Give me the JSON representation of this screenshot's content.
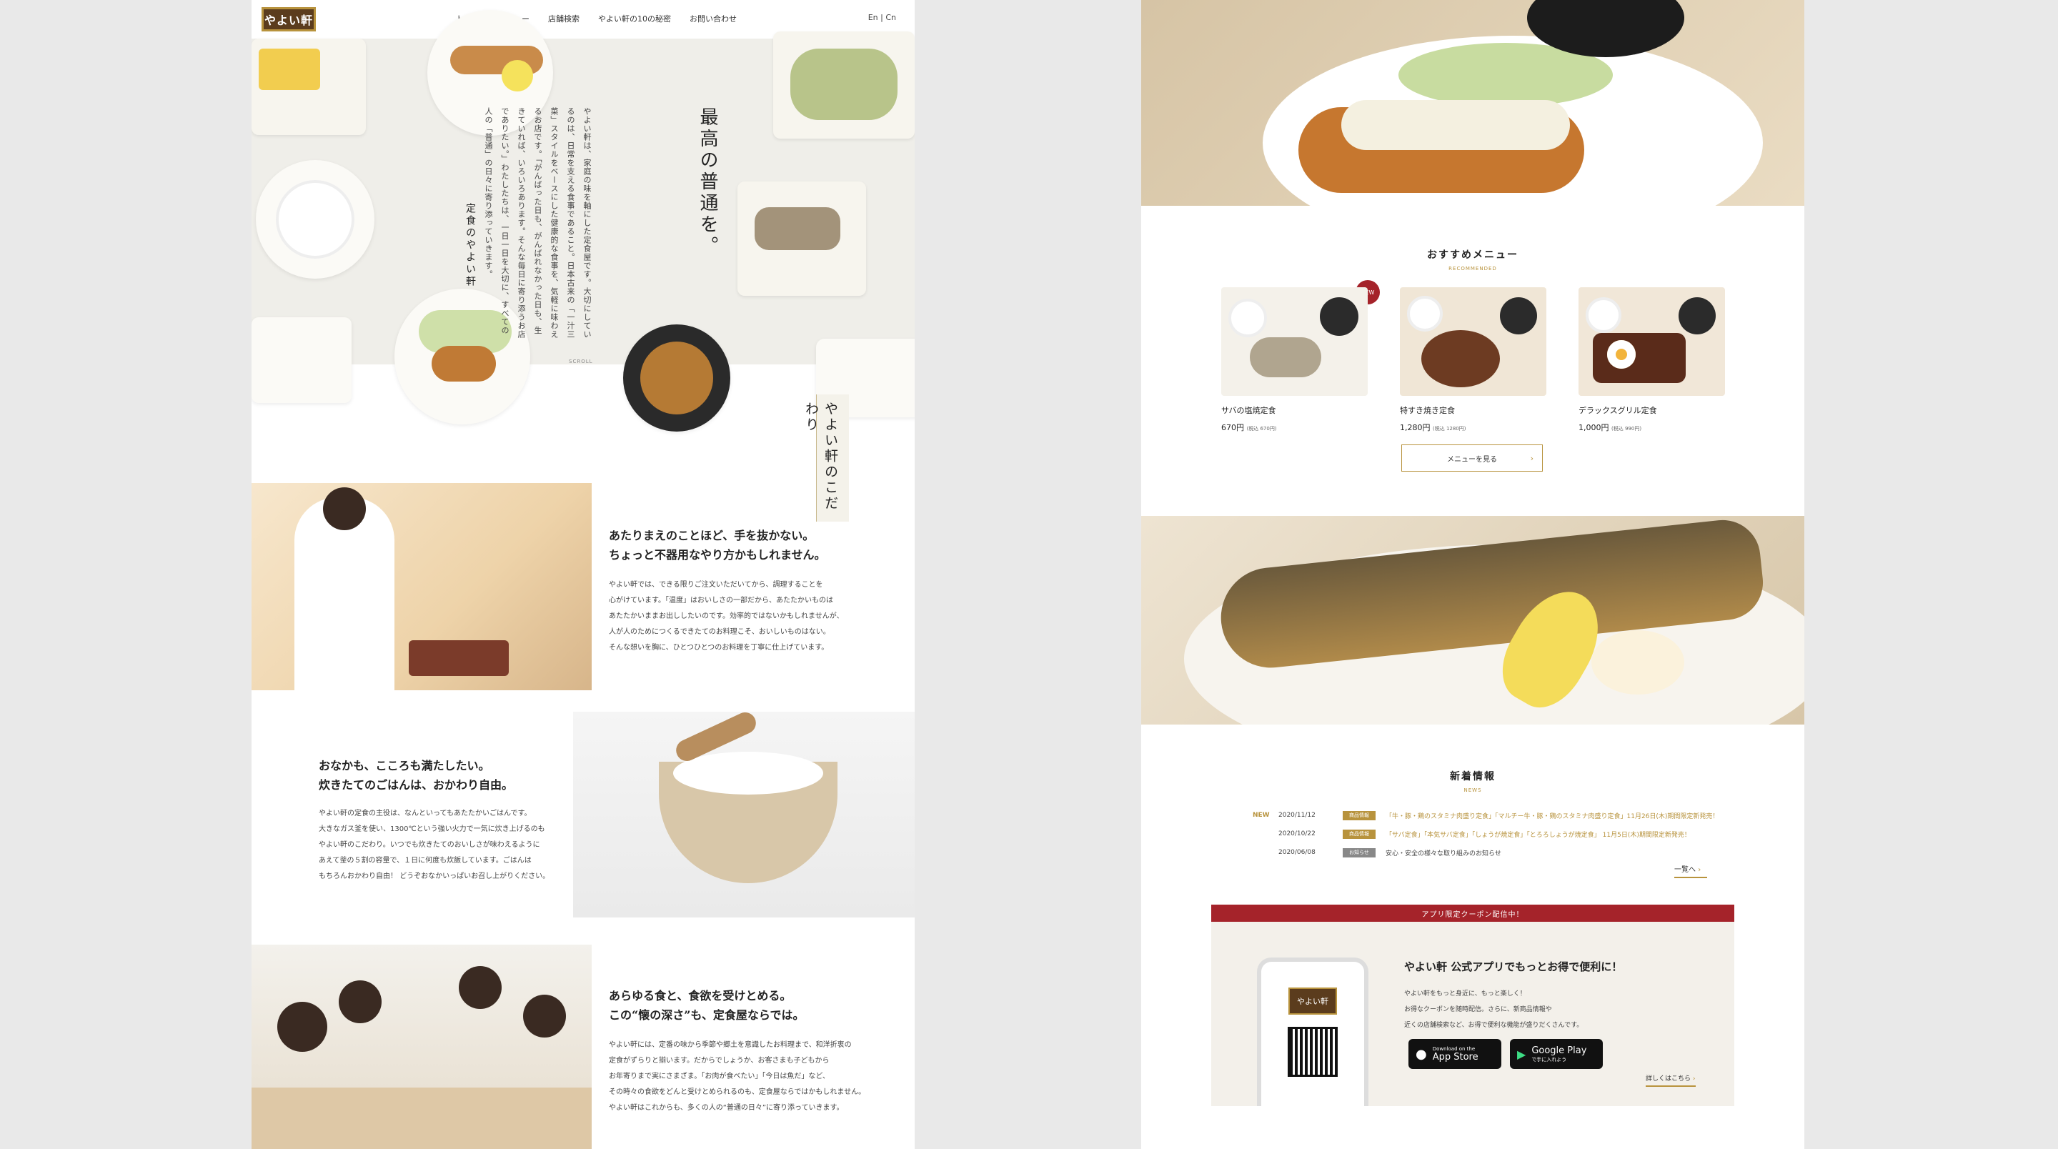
{
  "left_page": {
    "header": {
      "logo_text": "やよい軒",
      "nav": [
        "トップ",
        "メニュー",
        "店舗検索",
        "やよい軒の10の秘密",
        "お問い合わせ"
      ],
      "active_nav": "トップ",
      "lang": "En | Cn"
    },
    "hero": {
      "title": "最高の普通を。",
      "body": "やよい軒は、家庭の味を軸にした定食屋です。大切にしているのは、日常を支える食事であること。日本古来の「一汁三菜」スタイルをベースにした健康的な食事を、気軽に味わえるお店です。「がんばった日も、がんばれなかった日も、生きていれば、いろいろあります。そんな毎日に寄り添うお店でありたい。」わたしたちは、一日一日を大切に、すべての人の「普通」の日々に寄り添っていきます。",
      "signature": "定食のやよい軒",
      "scroll": "SCROLL"
    },
    "kodawari": {
      "vertical_heading": "やよい軒のこだわり",
      "sections": [
        {
          "heading_1": "あたりまえのことほど、手を抜かない。",
          "heading_2": "ちょっと不器用なやり方かもしれません。",
          "body": [
            "やよい軒では、できる限りご注文いただいてから、調理することを",
            "心がけています。「温度」はおいしさの一部だから、あたたかいものは",
            "あたたかいままお出ししたいのです。効率的ではないかもしれませんが、",
            "人が人のためにつくるできたてのお料理こそ、おいしいものはない。",
            "そんな想いを胸に、ひとつひとつのお料理を丁寧に仕上げています。"
          ]
        },
        {
          "heading_1": "おなかも、こころも満たしたい。",
          "heading_2": "炊きたてのごはんは、おかわり自由。",
          "body": [
            "やよい軒の定食の主役は、なんといってもあたたかいごはんです。",
            "大きなガス釜を使い、1300℃という強い火力で一気に炊き上げるのも",
            "やよい軒のこだわり。いつでも炊きたてのおいしさが味わえるように",
            "あえて釜の５割の容量で、１日に何度も炊飯しています。ごはんは",
            "もちろんおかわり自由！ どうぞおなかいっぱいお召し上がりください。"
          ]
        },
        {
          "heading_1": "あらゆる食と、食欲を受けとめる。",
          "heading_2": "この“懐の深さ”も、定食屋ならでは。",
          "body": [
            "やよい軒には、定番の味から季節や郷土を意識したお料理まで、和洋折衷の",
            "定食がずらりと揃います。だからでしょうか、お客さまも子どもから",
            "お年寄りまで実にさまざま。「お肉が食べたい」「今日は魚だ」など、",
            "その時々の食欲をどんと受けとめられるのも、定食屋ならではかもしれません。",
            "やよい軒はこれからも、多くの人の“普通の日々”に寄り添っていきます。"
          ]
        }
      ]
    }
  },
  "right_page": {
    "recommended": {
      "title": "おすすめメニュー",
      "subtitle": "RECOMMENDED",
      "new_badge": "NEW",
      "items": [
        {
          "name": "サバの塩焼定食",
          "price": "670円",
          "tax": "(税込 670円)"
        },
        {
          "name": "特すき焼き定食",
          "price": "1,280円",
          "tax": "(税込 1280円)"
        },
        {
          "name": "デラックスグリル定食",
          "price": "1,000円",
          "tax": "(税込 990円)"
        }
      ],
      "button": "メニューを見る"
    },
    "news": {
      "title": "新着情報",
      "subtitle": "NEWS",
      "items": [
        {
          "new": "NEW",
          "date": "2020/11/12",
          "tag": "商品情報",
          "text": "「牛・豚・鶏のスタミナ肉盛り定食」「マルチー牛・豚・鶏のスタミナ肉盛り定食」11月26日(木)期間限定新発売！"
        },
        {
          "new": "",
          "date": "2020/10/22",
          "tag": "商品情報",
          "text": "「サバ定食」「本気サバ定食」「しょうが焼定食」「とろろしょうが焼定食」 11月5日(木)期間限定新発売！"
        },
        {
          "new": "",
          "date": "2020/06/08",
          "tag": "お知らせ",
          "text": "安心・安全の様々な取り組みのお知らせ"
        }
      ],
      "more": "一覧へ"
    },
    "app": {
      "band": "アプリ限定クーポン配信中！",
      "title": "やよい軒 公式アプリでもっとお得で便利に！",
      "desc": [
        "やよい軒をもっと身近に、もっと楽しく！",
        "お得なクーポンを随時配信。さらに、新商品情報や",
        "近くの店舗検索など、お得で便利な機能が盛りだくさんです。"
      ],
      "phone_logo": "やよい軒",
      "app_store_small": "Download on the",
      "app_store": "App Store",
      "google_play_small": "で手に入れよう",
      "google_play": "Google Play",
      "detail_link": "詳しくはこちら"
    }
  },
  "colors": {
    "gold": "#b8933d",
    "brand_brown": "#5b3c1d",
    "red": "#a5232a"
  }
}
